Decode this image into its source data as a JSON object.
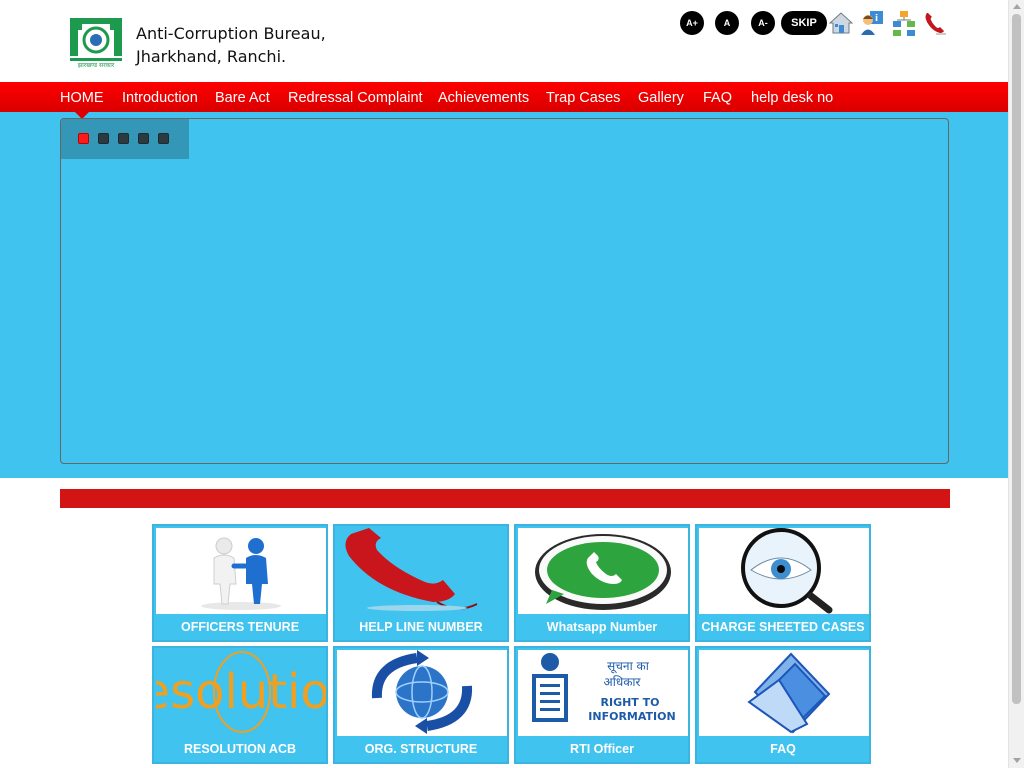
{
  "header": {
    "title_line1": "Anti-Corruption Bureau,",
    "title_line2": "Jharkhand, Ranchi.",
    "logo_icon": "jharkhand-emblem-icon"
  },
  "accessibility": {
    "font_increase": "A+",
    "font_normal": "A",
    "font_decrease": "A-",
    "skip": "SKIP",
    "icons": [
      "home-icon",
      "contact-person-icon",
      "sitemap-icon",
      "phone-icon"
    ]
  },
  "nav": {
    "items": [
      "HOME",
      "Introduction",
      "Bare Act",
      "Redressal Complaint",
      "Achievements",
      "Trap Cases",
      "Gallery",
      "FAQ",
      "help desk no"
    ]
  },
  "slider": {
    "dots": 5,
    "active_dot": 1
  },
  "tiles": [
    {
      "label": "OFFICERS TENURE",
      "icon": "handshake-icon"
    },
    {
      "label": "HELP LINE NUMBER",
      "icon": "telephone-receiver-icon"
    },
    {
      "label": "Whatsapp Number",
      "icon": "whatsapp-icon"
    },
    {
      "label": "CHARGE SHEETED CASES",
      "icon": "magnifier-eye-icon"
    },
    {
      "label": "RESOLUTION ACB",
      "icon": "resolution-text-icon",
      "image_text": "resolution"
    },
    {
      "label": "ORG. STRUCTURE",
      "icon": "globe-arrows-icon"
    },
    {
      "label": "RTI Officer",
      "icon": "right-to-information-icon",
      "image_text_hindi_1": "सूचना का",
      "image_text_hindi_2": "अधिकार",
      "image_text_1": "RIGHT TO",
      "image_text_2": "INFORMATION"
    },
    {
      "label": "FAQ",
      "icon": "blue-folder-icon"
    }
  ],
  "colors": {
    "nav_red": "#e00000",
    "banner_blue": "#40c3ee",
    "red_bar": "#d21414"
  }
}
